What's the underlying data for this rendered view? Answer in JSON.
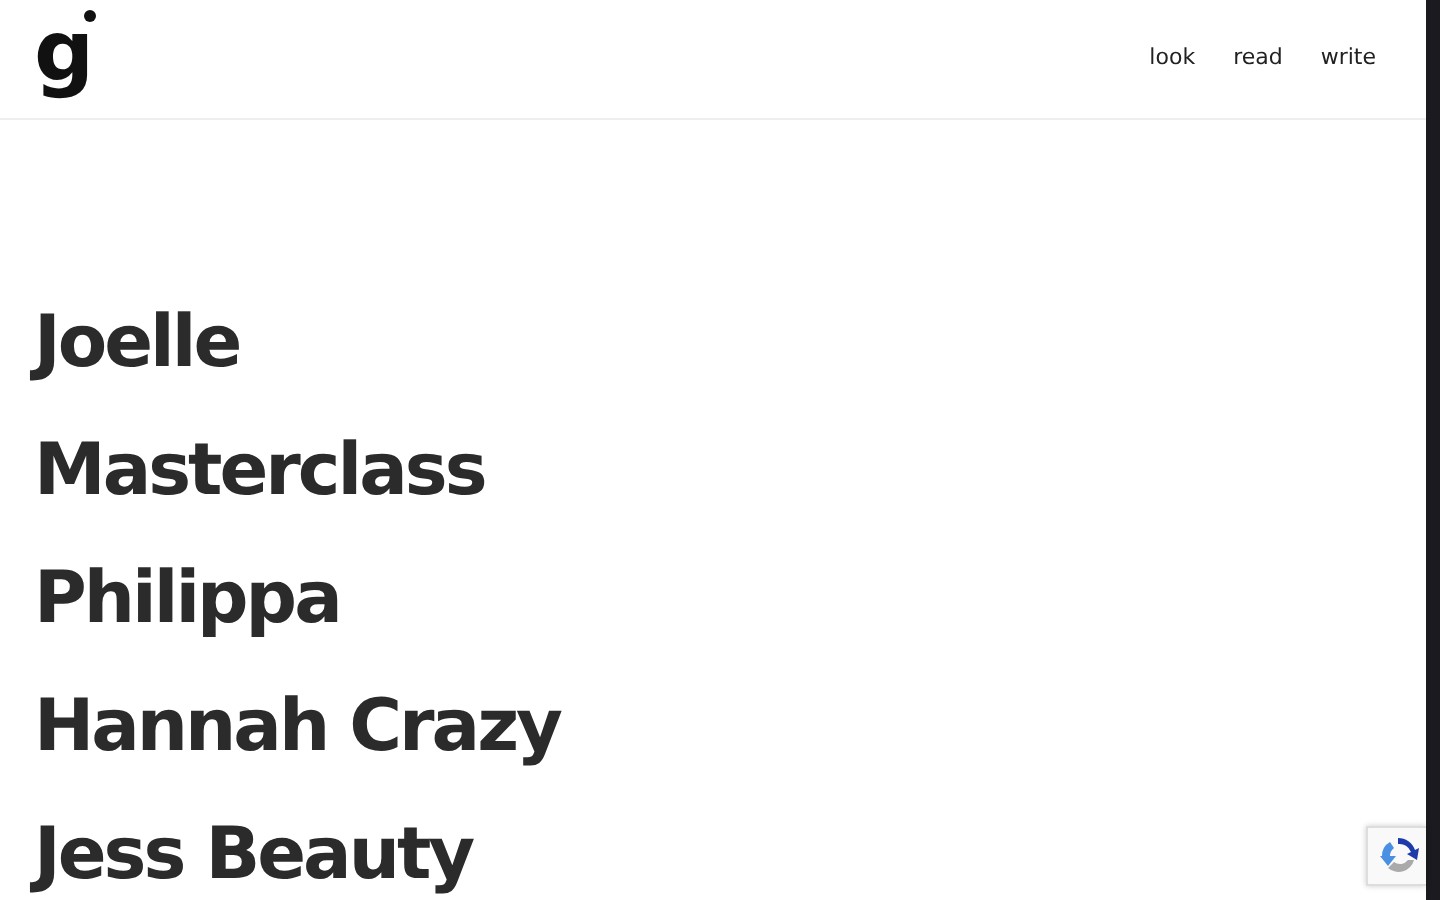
{
  "logo": {
    "text": "g"
  },
  "nav": [
    {
      "label": "look"
    },
    {
      "label": "read"
    },
    {
      "label": "write"
    }
  ],
  "titles": [
    "Joelle",
    "Masterclass",
    "Philippa",
    "Hannah Crazy",
    "Jess Beauty"
  ]
}
